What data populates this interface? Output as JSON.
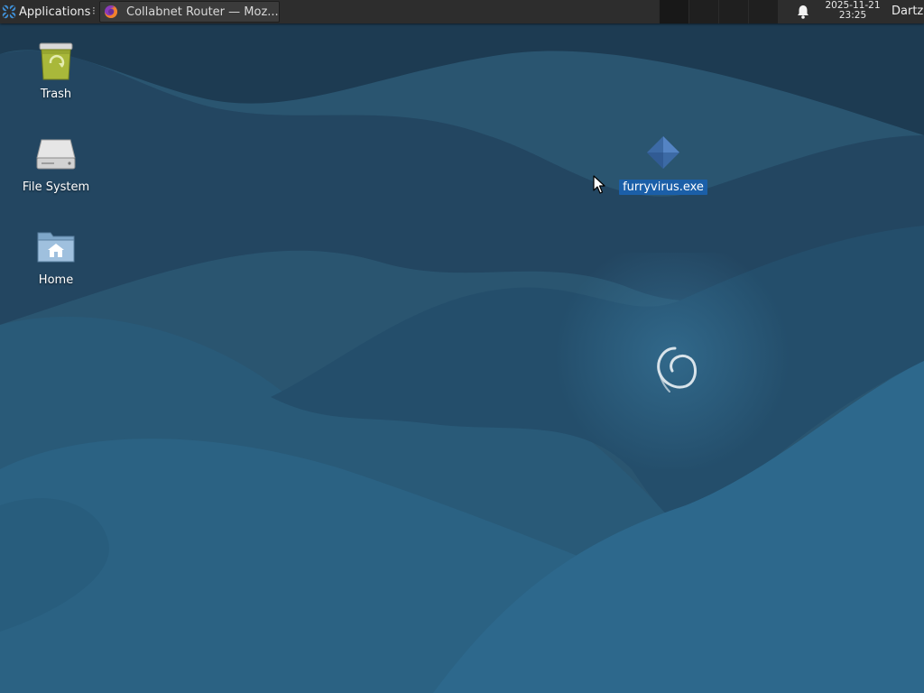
{
  "panel": {
    "app_menu_label": "Applications",
    "separator_glyph": "⁝",
    "task_title": "Collabnet Router — Moz...",
    "workspaces_count": 4,
    "active_workspace": 1,
    "clock_date": "2025-11-21",
    "clock_time": "23:25",
    "user_label": "Dartz"
  },
  "desktop": {
    "icons": [
      {
        "label": "Trash",
        "icon": "trash-icon"
      },
      {
        "label": "File System",
        "icon": "drive-icon"
      },
      {
        "label": "Home",
        "icon": "home-folder-icon"
      },
      {
        "label": "furryvirus.exe",
        "icon": "executable-file-icon",
        "selected": true
      }
    ]
  },
  "colors": {
    "panel_bg": "#2d2d2d",
    "wallpaper_dark": "#1f3f55",
    "wallpaper_mid": "#27546f",
    "wallpaper_light": "#2e6a8f",
    "selection": "#1b5fa8",
    "trash_green": "#a9b83a"
  }
}
